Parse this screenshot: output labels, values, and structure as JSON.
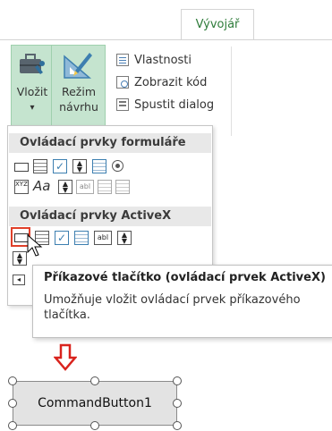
{
  "ribbon": {
    "tab_label": "Vývojář",
    "insert_label_line1": "Vložit",
    "insert_label_line2": "▾",
    "design_label_line1": "Režim",
    "design_label_line2": "návrhu",
    "items": {
      "properties": "Vlastnosti",
      "view_code": "Zobrazit kód",
      "run_dialog": "Spustit dialog"
    }
  },
  "dropdown": {
    "form_controls_header": "Ovládací prvky formuláře",
    "activex_controls_header": "Ovládací prvky ActiveX"
  },
  "tooltip": {
    "title": "Příkazové tlačítko (ovládací prvek ActiveX)",
    "text": "Umožňuje vložit ovládací prvek příkazového tlačítka."
  },
  "command_button": {
    "label": "CommandButton1"
  },
  "colors": {
    "accent_green": "#2e7c3a",
    "insert_highlight": "#c5e4cf",
    "arrow_red": "#d9231d",
    "selected_control_border": "#e0402a"
  }
}
